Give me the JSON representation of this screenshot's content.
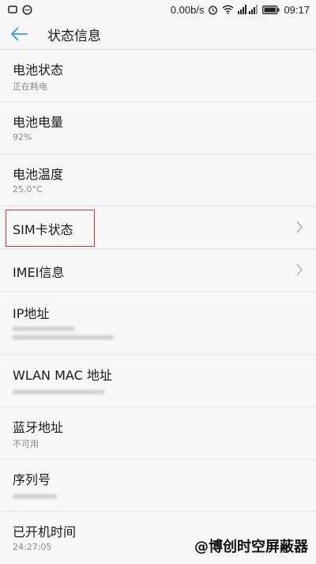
{
  "status_bar": {
    "speed": "0.00b/s",
    "time": "09:17",
    "left_icons": [
      "sim-icon",
      "messenger-icon"
    ],
    "right_icons": [
      "alarm-icon",
      "wifi-icon",
      "signal-icon",
      "battery-icon"
    ]
  },
  "header": {
    "title": "状态信息",
    "back_icon": "back-arrow-icon"
  },
  "items": [
    {
      "title": "电池状态",
      "value": "正在耗电"
    },
    {
      "title": "电池电量",
      "value": "92%"
    },
    {
      "title": "电池温度",
      "value": "25.0°C"
    },
    {
      "title": "SIM卡状态",
      "chevron": true
    },
    {
      "title": "IMEI信息",
      "chevron": true
    },
    {
      "title": "IP地址",
      "value_redacted": true
    },
    {
      "title": "WLAN MAC 地址",
      "value_redacted": true
    },
    {
      "title": "蓝牙地址",
      "value": "不可用"
    },
    {
      "title": "序列号",
      "value_redacted": true
    },
    {
      "title": "已开机时间",
      "value": "24:27:05"
    }
  ],
  "watermark": "@博创时空屏蔽器",
  "colors": {
    "accent": "#3a9bd9",
    "highlight": "#e03030",
    "background": "#f7f7f7",
    "divider": "#e4e4e4",
    "secondary_text": "#8a8a8a"
  }
}
